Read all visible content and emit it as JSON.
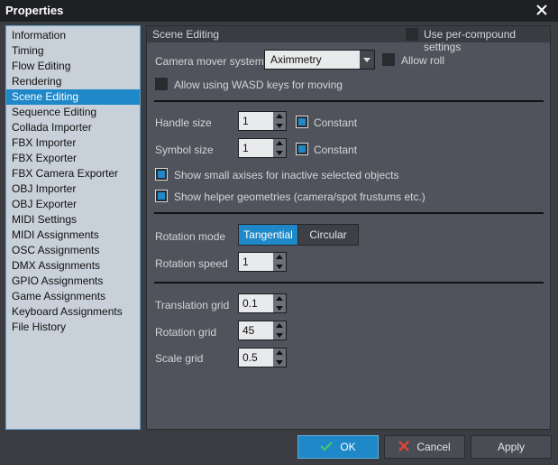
{
  "window": {
    "title": "Properties"
  },
  "sidebar": {
    "items": [
      {
        "label": "Information"
      },
      {
        "label": "Timing"
      },
      {
        "label": "Flow Editing"
      },
      {
        "label": "Rendering"
      },
      {
        "label": "Scene Editing",
        "selected": true
      },
      {
        "label": "Sequence Editing"
      },
      {
        "label": "Collada Importer"
      },
      {
        "label": "FBX Importer"
      },
      {
        "label": "FBX Exporter"
      },
      {
        "label": "FBX Camera Exporter"
      },
      {
        "label": "OBJ Importer"
      },
      {
        "label": "OBJ Exporter"
      },
      {
        "label": "MIDI Settings"
      },
      {
        "label": "MIDI Assignments"
      },
      {
        "label": "OSC Assignments"
      },
      {
        "label": "DMX Assignments"
      },
      {
        "label": "GPIO Assignments"
      },
      {
        "label": "Game Assignments"
      },
      {
        "label": "Keyboard Assignments"
      },
      {
        "label": "File History"
      }
    ]
  },
  "panel": {
    "title": "Scene Editing",
    "per_compound_label": "Use per-compound settings",
    "per_compound_checked": false,
    "camera_mover": {
      "label": "Camera mover system",
      "value": "Aximmetry"
    },
    "allow_roll": {
      "label": "Allow roll",
      "checked": false
    },
    "allow_wasd": {
      "label": "Allow using WASD keys for moving",
      "checked": false
    },
    "handle_size": {
      "label": "Handle size",
      "value": "1",
      "constant_label": "Constant",
      "constant_checked": true
    },
    "symbol_size": {
      "label": "Symbol size",
      "value": "1",
      "constant_label": "Constant",
      "constant_checked": true
    },
    "small_axises": {
      "label": "Show small axises for inactive selected objects",
      "checked": true
    },
    "helper_geom": {
      "label": "Show helper geometries (camera/spot frustums etc.)",
      "checked": true
    },
    "rotation_mode": {
      "label": "Rotation mode",
      "options": [
        "Tangential",
        "Circular"
      ],
      "selected": "Tangential"
    },
    "rotation_speed": {
      "label": "Rotation speed",
      "value": "1"
    },
    "translation_grid": {
      "label": "Translation grid",
      "value": "0.1"
    },
    "rotation_grid": {
      "label": "Rotation grid",
      "value": "45"
    },
    "scale_grid": {
      "label": "Scale grid",
      "value": "0.5"
    }
  },
  "footer": {
    "ok": "OK",
    "cancel": "Cancel",
    "apply": "Apply"
  },
  "colors": {
    "accent": "#1e88c8",
    "ok_check": "#4fc36a",
    "cancel_x": "#e0443a"
  }
}
